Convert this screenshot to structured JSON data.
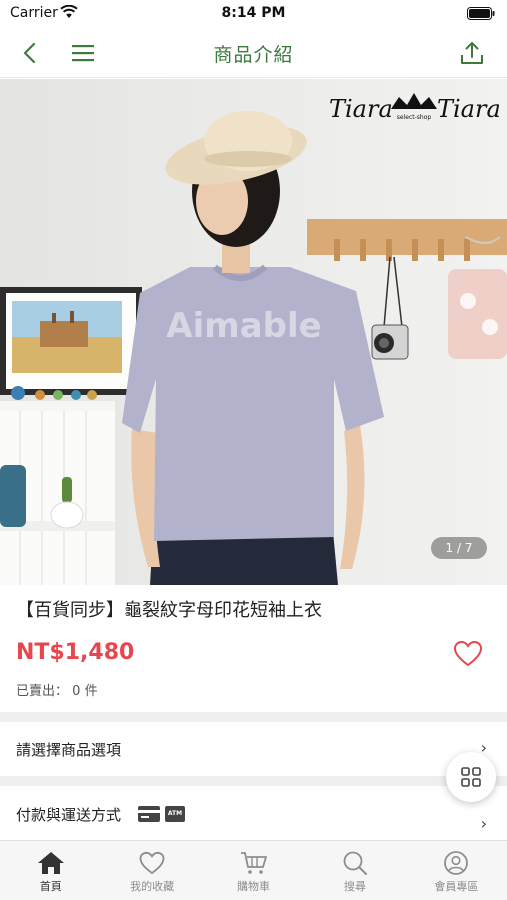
{
  "status_bar": {
    "carrier": "Carrier",
    "time": "8:14 PM"
  },
  "nav": {
    "title": "商品介紹"
  },
  "hero": {
    "brand": "Tiara",
    "brand_tagline": "select-shop",
    "shirt_print": "Aimable",
    "page_indicator": "1 / 7"
  },
  "product": {
    "title": "【百貨同步】龜裂紋字母印花短袖上衣",
    "price": "NT$1,480",
    "sold_label": "已賣出：",
    "sold_count": "0",
    "sold_unit": "件"
  },
  "options_row": {
    "label": "請選擇商品選項",
    "chevron": "›"
  },
  "payment_row": {
    "label": "付款與運送方式",
    "chevron": "›",
    "atm_label": "ATM"
  },
  "tabs": [
    {
      "label": "首頁",
      "icon": "home-icon",
      "active": true
    },
    {
      "label": "我的收藏",
      "icon": "heart-icon",
      "active": false
    },
    {
      "label": "購物車",
      "icon": "cart-icon",
      "active": false
    },
    {
      "label": "搜尋",
      "icon": "search-icon",
      "active": false
    },
    {
      "label": "會員專區",
      "icon": "user-icon",
      "active": false
    }
  ],
  "colors": {
    "accent": "#3e7a3e",
    "price": "#e8464e",
    "favorite": "#e8464e"
  }
}
